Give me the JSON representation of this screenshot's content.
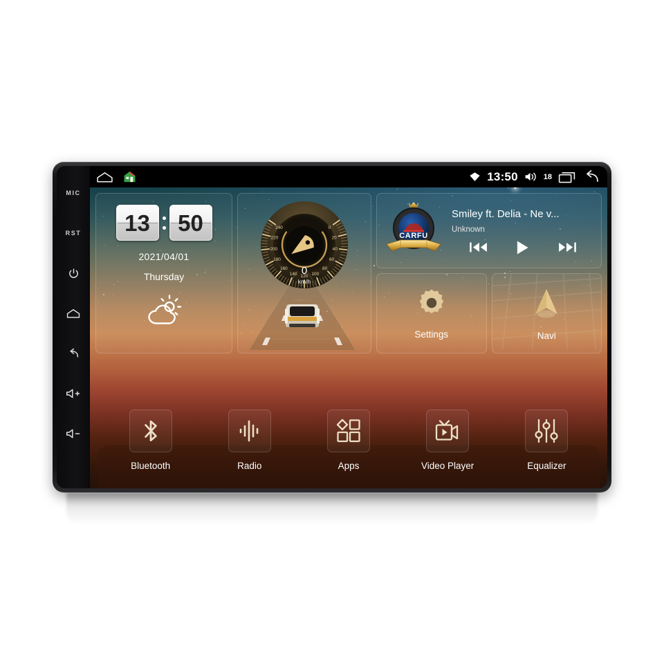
{
  "device": {
    "hard_keys": [
      {
        "name": "mic",
        "label": "MIC",
        "type": "text"
      },
      {
        "name": "reset",
        "label": "RST",
        "type": "text"
      },
      {
        "name": "power",
        "label": "power-icon",
        "type": "icon"
      },
      {
        "name": "home",
        "label": "home-icon",
        "type": "icon"
      },
      {
        "name": "back",
        "label": "back-icon",
        "type": "icon"
      },
      {
        "name": "volume-up",
        "label": "volume-up-icon",
        "type": "icon"
      },
      {
        "name": "volume-down",
        "label": "volume-down-icon",
        "type": "icon"
      }
    ]
  },
  "statusbar": {
    "left_icons": [
      "home-outline-icon",
      "house-app-icon"
    ],
    "signal_icon": "wifi-diamond-icon",
    "time": "13:50",
    "volume_icon": "volume-icon",
    "volume_level": "18",
    "recents_icon": "recents-icon",
    "back_icon": "back-arrow-icon"
  },
  "clock_widget": {
    "hours": "13",
    "minutes": "50",
    "date": "2021/04/01",
    "weekday": "Thursday",
    "weather_icon": "partly-cloudy-icon"
  },
  "drive_widget": {
    "speed_value": "0",
    "speed_unit": "km/h",
    "gauge_ticks": [
      "0",
      "20",
      "40",
      "60",
      "80",
      "100",
      "120",
      "140",
      "160",
      "180",
      "200",
      "220",
      "240"
    ],
    "gauge_min": 0,
    "gauge_max": 240,
    "needle_value": 0
  },
  "music_widget": {
    "album_art": "carfu-badge-logo",
    "album_art_text": "CARFU",
    "title": "Smiley ft. Delia - Ne v...",
    "artist": "Unknown",
    "controls": [
      {
        "name": "previous-track-button",
        "icon": "skip-previous-icon"
      },
      {
        "name": "play-button",
        "icon": "play-icon"
      },
      {
        "name": "next-track-button",
        "icon": "skip-next-icon"
      }
    ]
  },
  "tiles": [
    {
      "name": "settings",
      "label": "Settings",
      "icon": "gear-icon"
    },
    {
      "name": "navi",
      "label": "Navi",
      "icon": "navigation-arrow-icon"
    }
  ],
  "dock": [
    {
      "name": "bluetooth",
      "label": "Bluetooth",
      "icon": "bluetooth-icon"
    },
    {
      "name": "radio",
      "label": "Radio",
      "icon": "waveform-icon"
    },
    {
      "name": "apps",
      "label": "Apps",
      "icon": "apps-grid-icon"
    },
    {
      "name": "video-player",
      "label": "Video Player",
      "icon": "camcorder-play-icon"
    },
    {
      "name": "equalizer",
      "label": "Equalizer",
      "icon": "equalizer-sliders-icon"
    }
  ],
  "colors": {
    "accent_gold": "#e4c68a",
    "statusbar_bg": "#000000",
    "text_primary": "#ffffff",
    "sky_top": "#10323f",
    "ground_bottom": "#24120a"
  }
}
